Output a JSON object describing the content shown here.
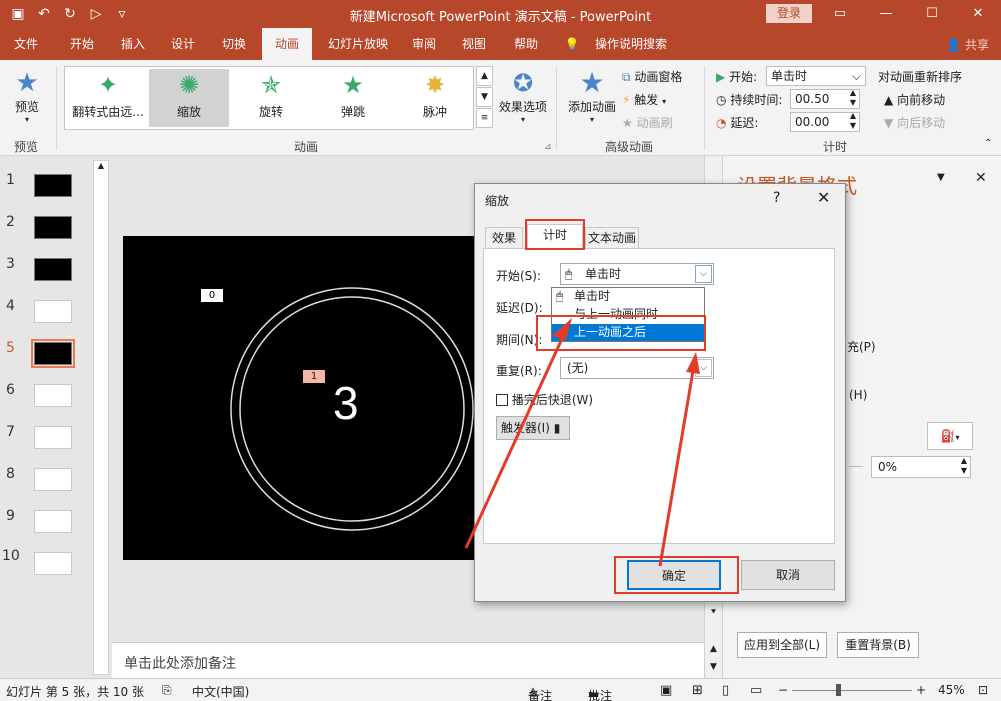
{
  "window": {
    "title": "新建Microsoft PowerPoint 演示文稿  -  PowerPoint",
    "login_label": "登录",
    "min_icon": "—",
    "max_icon": "☐",
    "close_icon": "✕"
  },
  "tabs": [
    {
      "label": "文件"
    },
    {
      "label": "开始"
    },
    {
      "label": "插入"
    },
    {
      "label": "设计"
    },
    {
      "label": "切换"
    },
    {
      "label": "动画"
    },
    {
      "label": "幻灯片放映"
    },
    {
      "label": "审阅"
    },
    {
      "label": "视图"
    },
    {
      "label": "帮助"
    },
    {
      "label": "操作说明搜索"
    }
  ],
  "share_label": "共享",
  "ribbon": {
    "preview_label": "预览",
    "preview_group": "预览",
    "animation_group": "动画",
    "gallery": [
      {
        "label": "翻转式由远..."
      },
      {
        "label": "缩放"
      },
      {
        "label": "旋转"
      },
      {
        "label": "弹跳"
      },
      {
        "label": "脉冲"
      }
    ],
    "effect_options": "效果选项",
    "add_animation": "添加动画",
    "animation_pane": "动画窗格",
    "trigger": "触发",
    "animation_painter": "动画刷",
    "advanced_group": "高级动画",
    "start_label": "开始:",
    "start_value": "单击时",
    "duration_label": "持续时间:",
    "duration_value": "00.50",
    "delay_label": "延迟:",
    "delay_value": "00.00",
    "timing_group": "计时",
    "reorder_title": "对动画重新排序",
    "move_earlier": "向前移动",
    "move_later": "向后移动"
  },
  "thumbnails": [
    "1",
    "2",
    "3",
    "4",
    "5",
    "6",
    "7",
    "8",
    "9",
    "10"
  ],
  "slide": {
    "tag_0": "0",
    "tag_1": "1",
    "number": "3"
  },
  "notes_placeholder": "单击此处添加备注",
  "format_pane": {
    "title": "设置背景格式",
    "fill_fragment": "充(P)",
    "hide_fragment": "(H)",
    "transparency_value": "0%",
    "apply_all": "应用到全部(L)",
    "reset_background": "重置背景(B)"
  },
  "dialog": {
    "title": "缩放",
    "help": "?",
    "close": "✕",
    "tabs": [
      {
        "label": "效果"
      },
      {
        "label": "计时"
      },
      {
        "label": "文本动画"
      }
    ],
    "start_label": "开始(S):",
    "start_value": "单击时",
    "delay_label": "延迟(D):",
    "period_label": "期间(N):",
    "repeat_label": "重复(R):",
    "repeat_value": "(无)",
    "rewind_label": "播完后快退(W)",
    "trigger_label": "触发器(I)",
    "dropdown_options": [
      {
        "label": "单击时"
      },
      {
        "label": "与上一动画同时"
      },
      {
        "label": "上一动画之后"
      }
    ],
    "ok": "确定",
    "cancel": "取消"
  },
  "status": {
    "slide_info": "幻灯片 第 5 张，共 10 张",
    "language": "中文(中国)",
    "notes": "备注",
    "comments": "批注",
    "zoom": "45%"
  },
  "colors": {
    "accent": "#b7472a",
    "highlight": "#0078d7",
    "annotation": "#e23b2a"
  }
}
